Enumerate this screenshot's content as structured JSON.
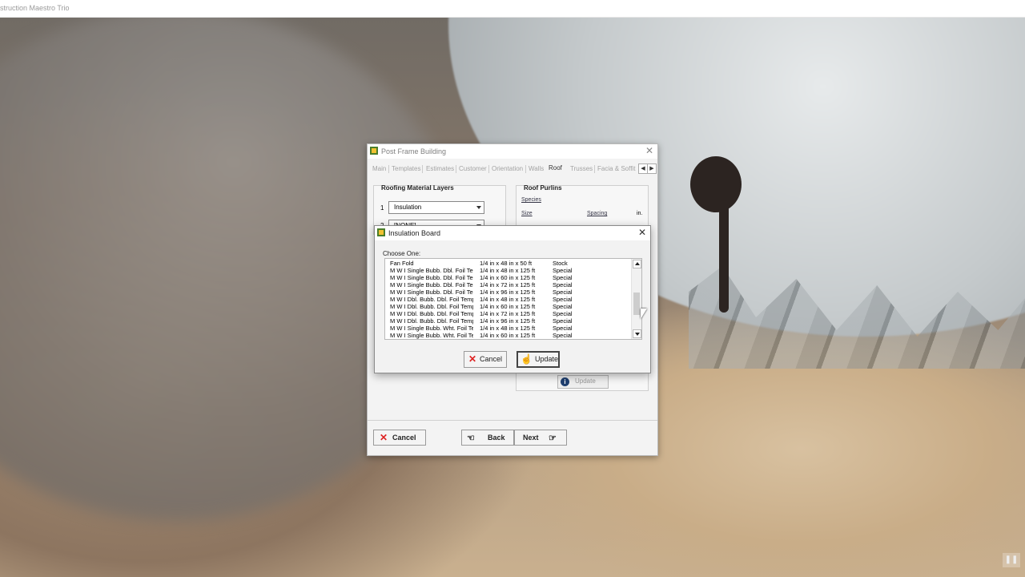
{
  "app_title": "struction Maestro Trio",
  "main_window": {
    "title": "Post Frame Building",
    "tabs": [
      "Main",
      "Templates",
      "Estimates",
      "Customer",
      "Orientation",
      "Walls",
      "Roof",
      "Trusses",
      "Facia & Soffit"
    ],
    "active_tab": "Roof",
    "roofing_group": {
      "title": "Roofing Material Layers",
      "layers": [
        {
          "num": "1",
          "value": "Insulation"
        },
        {
          "num": "2",
          "value": "[NONE]"
        }
      ]
    },
    "purlins_group": {
      "title": "Roof Purlins",
      "species_label": "Species",
      "size_label": "Size",
      "spacing_label": "Spacing",
      "unit": "in."
    },
    "update_label": "Update",
    "buttons": {
      "cancel": "Cancel",
      "back": "Back",
      "next": "Next"
    }
  },
  "modal": {
    "title": "Insulation Board",
    "choose_label": "Choose One:",
    "rows": [
      {
        "name": "Fan Fold",
        "size": "1/4 in  x  48 in  x  50 ft",
        "status": "Stock"
      },
      {
        "name": "M W I Single Bubb. Dbl. Foil Temp",
        "size": "1/4 in  x  48 in  x  125 ft",
        "status": "Special"
      },
      {
        "name": "M W I Single Bubb. Dbl. Foil Temp",
        "size": "1/4 in  x  60 in  x  125 ft",
        "status": "Special"
      },
      {
        "name": "M W I Single Bubb. Dbl. Foil Temp",
        "size": "1/4 in  x  72 in  x  125 ft",
        "status": "Special"
      },
      {
        "name": "M W I Single Bubb. Dbl. Foil Temp",
        "size": "1/4 in  x  96 in  x  125 ft",
        "status": "Special"
      },
      {
        "name": "M W I Dbl. Bubb. Dbl. Foil Temp",
        "size": "1/4 in  x  48 in  x  125 ft",
        "status": "Special"
      },
      {
        "name": "M W I Dbl. Bubb. Dbl. Foil Temp",
        "size": "1/4 in  x  60 in  x  125 ft",
        "status": "Special"
      },
      {
        "name": "M W I Dbl. Bubb. Dbl. Foil Temp",
        "size": "1/4 in  x  72 in  x  125 ft",
        "status": "Special"
      },
      {
        "name": "M W I Dbl. Bubb. Dbl. Foil Temp",
        "size": "1/4 in  x  96 in  x  125 ft",
        "status": "Special"
      },
      {
        "name": "M W I Single Bubb. Wht. Foil Temp",
        "size": "1/4 in  x  48 in  x  125 ft",
        "status": "Special"
      },
      {
        "name": "M W I Single Bubb. Wht. Foil Temp",
        "size": "1/4 in  x  60 in  x  125 ft",
        "status": "Special"
      }
    ],
    "buttons": {
      "cancel": "Cancel",
      "update": "Update"
    }
  }
}
